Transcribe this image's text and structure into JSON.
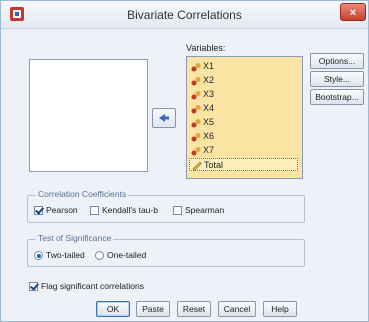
{
  "window": {
    "title": "Bivariate Correlations",
    "close": "×"
  },
  "variables": {
    "label": "Variables:",
    "items": [
      {
        "name": "X1",
        "icon": "scale-variable-icon"
      },
      {
        "name": "X2",
        "icon": "scale-variable-icon"
      },
      {
        "name": "X3",
        "icon": "scale-variable-icon"
      },
      {
        "name": "X4",
        "icon": "scale-variable-icon"
      },
      {
        "name": "X5",
        "icon": "scale-variable-icon"
      },
      {
        "name": "X6",
        "icon": "scale-variable-icon"
      },
      {
        "name": "X7",
        "icon": "scale-variable-icon"
      },
      {
        "name": "Total",
        "icon": "ruler-icon",
        "selected": true
      }
    ]
  },
  "side_buttons": {
    "options": "Options...",
    "style": "Style...",
    "bootstrap": "Bootstrap..."
  },
  "coefficients": {
    "legend": "Correlation Coefficients",
    "pearson": {
      "label": "Pearson",
      "checked": true
    },
    "kendall": {
      "label": "Kendall's tau-b",
      "checked": false
    },
    "spearman": {
      "label": "Spearman",
      "checked": false
    }
  },
  "significance": {
    "legend": "Test of Significance",
    "two_tailed": {
      "label": "Two-tailed",
      "selected": true
    },
    "one_tailed": {
      "label": "One-tailed",
      "selected": false
    }
  },
  "flag": {
    "label": "Flag significant correlations",
    "checked": true
  },
  "buttons": {
    "ok": "OK",
    "paste": "Paste",
    "reset": "Reset",
    "cancel": "Cancel",
    "help": "Help"
  },
  "colors": {
    "list_bg": "#fce4a4",
    "accent": "#1b5fb8",
    "close": "#c7402d"
  }
}
